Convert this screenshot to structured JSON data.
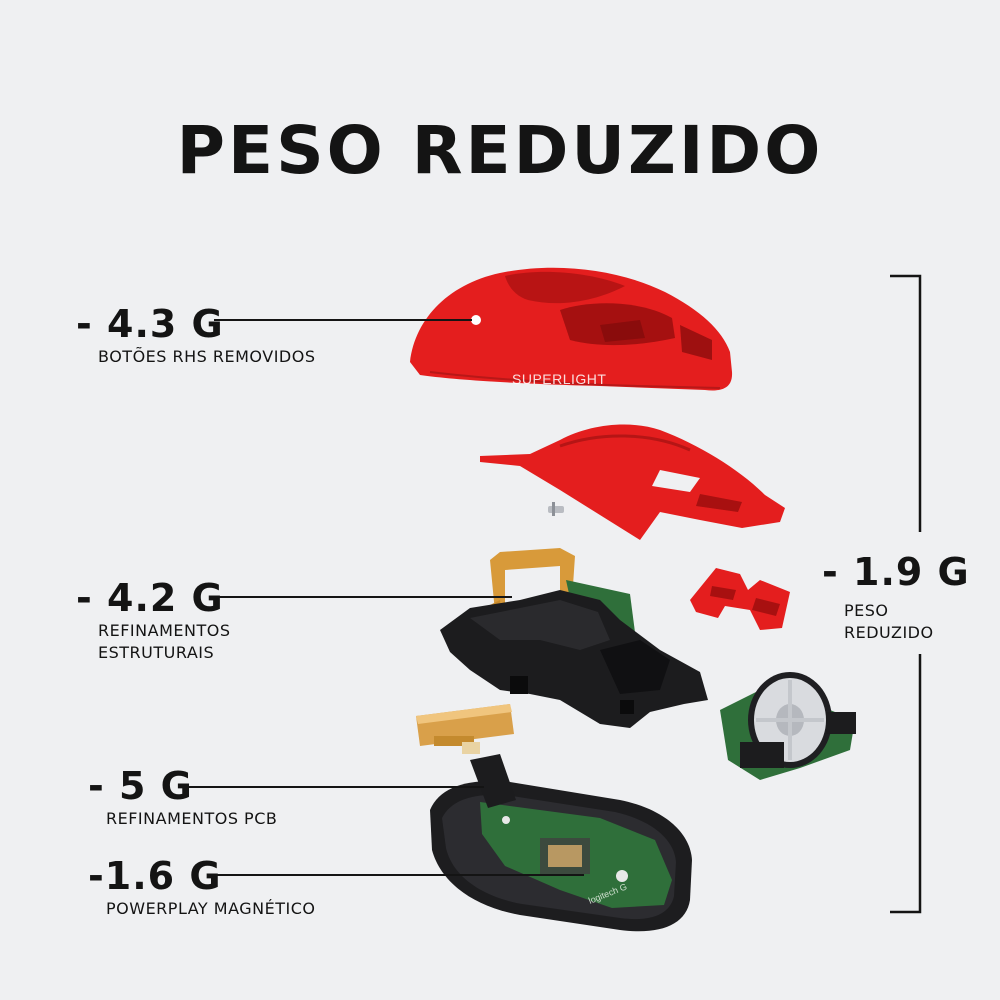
{
  "title": "PESO REDUZIDO",
  "callouts": [
    {
      "value": "- 4.3 G",
      "label": "BOTÕES RHS REMOVIDOS"
    },
    {
      "value": "- 4.2 G",
      "label": "REFINAMENTOS ESTRUTURAIS"
    },
    {
      "value": "- 5 G",
      "label": "REFINAMENTOS PCB"
    },
    {
      "value": "-1.6 G",
      "label": "POWERPLAY MAGNÉTICO"
    }
  ],
  "total": {
    "value": "- 1.9 G",
    "label": "PESO REDUZIDO"
  },
  "shell_text": "SUPERLIGHT",
  "pcb_text": "logitech G",
  "colors": {
    "shell": "#e41e1e",
    "frame": "#1c1c1e",
    "pcb": "#2f6f3a",
    "background": "#eff0f2"
  }
}
